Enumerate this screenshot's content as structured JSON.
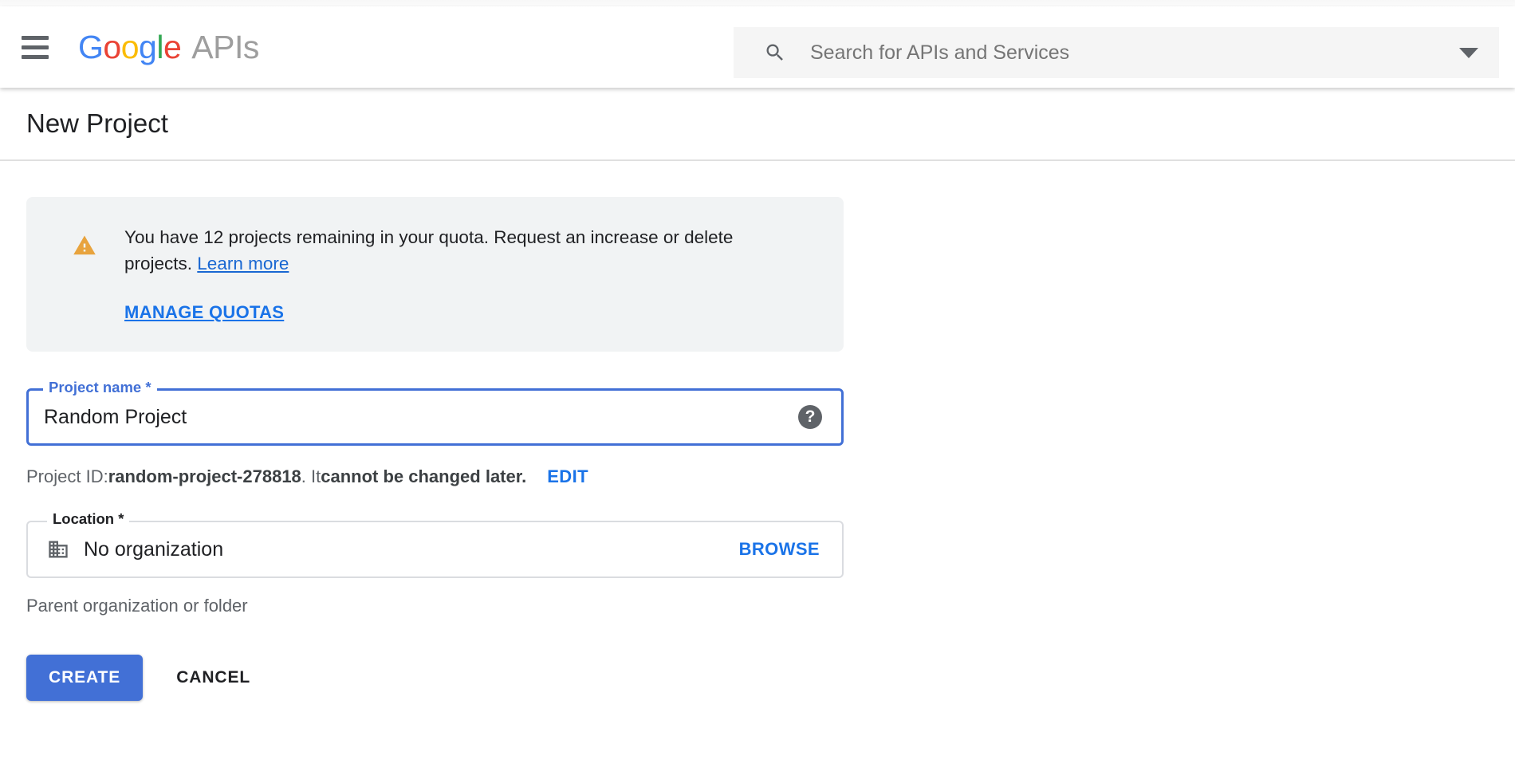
{
  "header": {
    "menu_icon": "hamburger-menu-icon",
    "brand": {
      "g1": "G",
      "o1": "o",
      "o2": "o",
      "g2": "g",
      "l1": "l",
      "e1": "e",
      "suffix": "APIs"
    },
    "search": {
      "icon": "search-icon",
      "placeholder": "Search for APIs and Services",
      "value": "",
      "dropdown_icon": "chevron-down-icon"
    }
  },
  "page": {
    "title": "New Project"
  },
  "notice": {
    "icon": "warning-triangle-icon",
    "icon_color": "#e8a33d",
    "text_before_link": "You have 12 projects remaining in your quota. Request an increase or delete projects. ",
    "inline_link": "Learn more",
    "action_label": "MANAGE QUOTAS",
    "background": "#f1f3f4"
  },
  "form": {
    "project_name": {
      "label": "Project name *",
      "value": "Random Project",
      "placeholder": "",
      "help_icon": "help-circle-icon",
      "focused": true,
      "accent_color": "#4270d6"
    },
    "project_id": {
      "prefix": "Project ID: ",
      "id_value": "random-project-278818",
      "middle": ". It ",
      "emphasis": "cannot be changed later.",
      "edit_label": "EDIT"
    },
    "location": {
      "label": "Location *",
      "icon": "organization-building-icon",
      "value": "No organization",
      "browse_label": "BROWSE",
      "hint": "Parent organization or folder"
    }
  },
  "actions": {
    "create_label": "CREATE",
    "cancel_label": "CANCEL",
    "primary_color": "#4270d6"
  }
}
